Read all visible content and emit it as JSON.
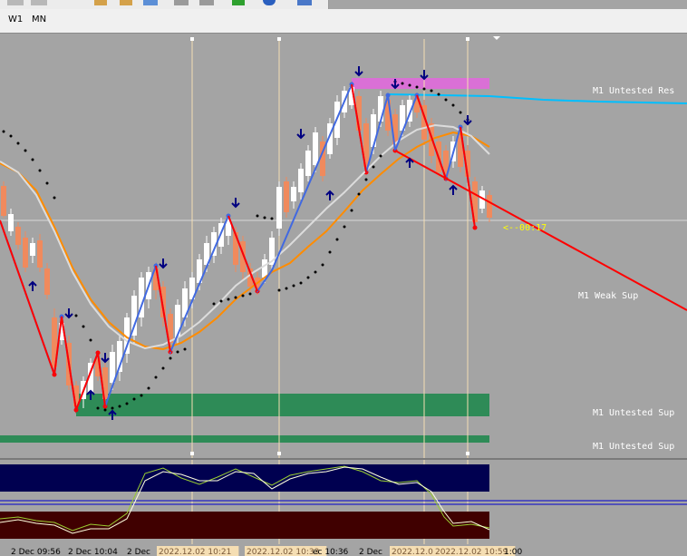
{
  "toolbar": {
    "timeframes": [
      "W1",
      "MN"
    ]
  },
  "levels": {
    "resistance": "M1 Untested Res",
    "weak_support": "M1 Weak Sup",
    "support1": "M1 Untested Sup",
    "support2": "M1 Untested Sup"
  },
  "timer": "<--00:17",
  "time_axis": {
    "ticks": [
      "2 Dec 09:56",
      "2 Dec 10:04",
      "2 Dec",
      "2022.12.02 10:21",
      "2022.12.02 10:33",
      "ec 10:36",
      "2 Dec",
      "2022.12.02",
      "2022.12.02 10:59",
      "1:00"
    ]
  },
  "colors": {
    "chart_bg": "#a4a4a4",
    "bull_candle": "#ffffff",
    "bear_candle": "#f08a5d",
    "zigzag_up": "#4169e1",
    "zigzag_down": "#ff0000",
    "ma_orange": "#ff8c00",
    "ma_white": "#dcdcdc",
    "resistance_zone": "#da70d6",
    "support_zone": "#2e8b57",
    "resistance_line": "#00bfff",
    "osc_blue": "#000050",
    "osc_red": "#400000"
  }
}
